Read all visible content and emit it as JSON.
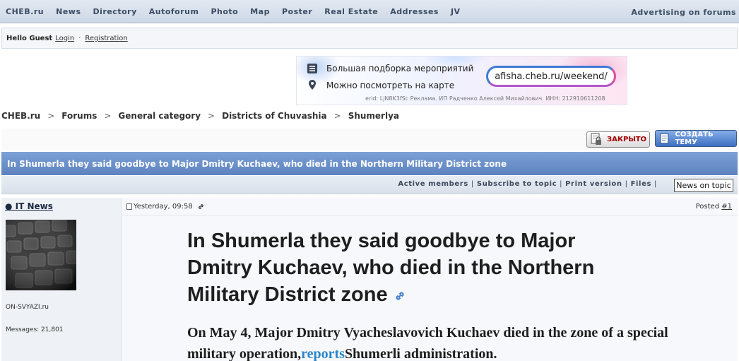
{
  "nav": {
    "items": [
      "CHEB.ru",
      "News",
      "Directory",
      "Autoforum",
      "Photo",
      "Map",
      "Poster",
      "Real Estate",
      "Addresses",
      "JV"
    ],
    "right": "Advertising on forums"
  },
  "userbar": {
    "hello": "Hello Guest",
    "login": "Login",
    "sep": "·",
    "register": "Registration"
  },
  "banner": {
    "line1": "Большая подборка мероприятий",
    "line2": "Можно посмотреть на карте",
    "url": "afisha.cheb.ru/weekend/",
    "erid": "erid: LjN8K3fSc Реклама. ИП Радченко Алексей Михайлович. ИНН: 212910611208"
  },
  "breadcrumb": {
    "items": [
      "CHEB.ru",
      "Forums",
      "General category",
      "Districts of Chuvashia",
      "Shumerlya"
    ],
    "sep": ">"
  },
  "buttons": {
    "closed": "ЗАКРЫТО",
    "new_topic": "СОЗДАТЬ ТЕМУ"
  },
  "topic": {
    "title": "In Shumerla they said goodbye to Major Dmitry Kuchaev, who died in the Northern Military District zone"
  },
  "options": {
    "items": [
      "Active members",
      "Subscribe to topic",
      "Print version",
      "Files"
    ],
    "sep": "|",
    "news": "News on topic"
  },
  "post": {
    "author": "● IT News",
    "site": "ON-SVYAZI.ru",
    "messages": "Messages: 21,801",
    "date": "Yesterday, 09:58",
    "posted_label": "Posted",
    "post_num": "#1",
    "headline": "In Shumerla they said goodbye to Major Dmitry Kuchaev, who died in the Northern Military District zone",
    "lead_before": "On May 4, Major Dmitry Vyacheslavovich Kuchaev died in the zone of a special military operation,",
    "lead_link": "reports",
    "lead_after": "Shumerli administration."
  }
}
